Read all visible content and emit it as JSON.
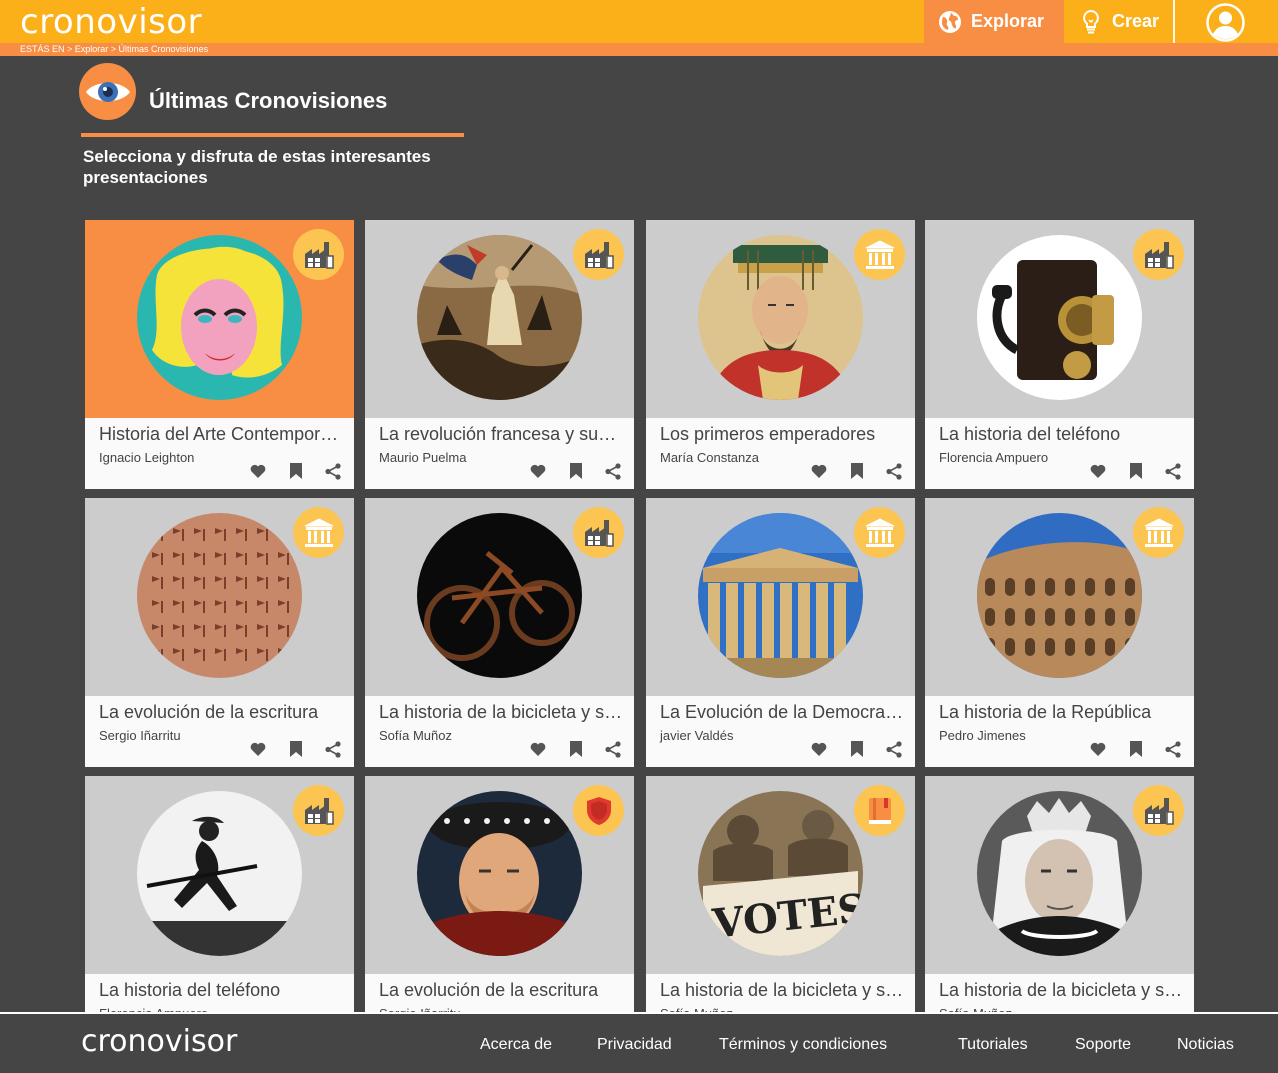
{
  "header": {
    "logo": "cronovisor",
    "nav": {
      "explorar": "Explorar",
      "crear": "Crear"
    },
    "breadcrumb": "ESTÁS EN > Explorar > Últimas Cronovisiones"
  },
  "page": {
    "title": "Últimas Cronovisiones",
    "subtitle": "Selecciona y disfruta de estas interesantes presentaciones"
  },
  "cards": [
    {
      "title": "Historia del Arte Contemporáneo",
      "author": "Ignacio Leighton",
      "badge": "factory-icon",
      "image": "pop-art-portrait"
    },
    {
      "title": "La revolución francesa y sus consecuencias",
      "author": "Maurio Puelma",
      "badge": "factory-icon",
      "image": "liberty-painting"
    },
    {
      "title": "Los primeros emperadores",
      "author": "María Constanza",
      "badge": "temple-icon",
      "image": "chinese-emperor"
    },
    {
      "title": "La historia del teléfono",
      "author": "Florencia Ampuero",
      "badge": "factory-icon",
      "image": "antique-telephone"
    },
    {
      "title": "La evolución de la escritura",
      "author": "Sergio Iñarritu",
      "badge": "temple-icon",
      "image": "cuneiform-tablet"
    },
    {
      "title": "La historia de la bicicleta y su evolución",
      "author": "Sofía Muñoz",
      "badge": "factory-icon",
      "image": "wooden-bicycle"
    },
    {
      "title": "La Evolución de la Democracia",
      "author": "javier Valdés",
      "badge": "temple-icon",
      "image": "parthenon"
    },
    {
      "title": "La historia de la República",
      "author": "Pedro Jimenes",
      "badge": "temple-icon",
      "image": "colosseum"
    },
    {
      "title": "La historia del teléfono",
      "author": "Florencia Ampuero",
      "badge": "factory-icon",
      "image": "running-soldier"
    },
    {
      "title": "La evolución de la escritura",
      "author": "Sergio Iñarritu",
      "badge": "shield-icon",
      "image": "tudor-king"
    },
    {
      "title": "La historia de la bicicleta y su evolución",
      "author": "Sofía Muñoz",
      "badge": "book-icon",
      "image": "votes-for-women"
    },
    {
      "title": "La historia de la bicicleta y su evolución",
      "author": "Sofía Muñoz",
      "badge": "factory-icon",
      "image": "queen-portrait"
    }
  ],
  "footer": {
    "logo": "cronovisor",
    "links": [
      "Acerca de",
      "Privacidad",
      "Términos y condiciones",
      "Tutoriales",
      "Soporte",
      "Noticias"
    ]
  },
  "colors": {
    "primary": "#fbb01a",
    "accent": "#f78e43",
    "background": "#454545",
    "badge": "#fcc552"
  }
}
